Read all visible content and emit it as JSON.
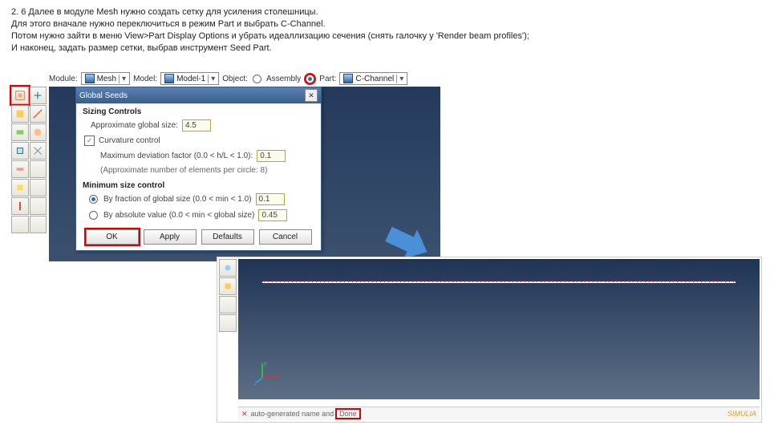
{
  "instructions": {
    "l1": "2. 6 Далее в модуле Mesh нужно создать сетку для усиления столешницы.",
    "l2": "Для этого вначале нужно переключиться в режим Part и выбрать C-Channel.",
    "l3": "Потом нужно зайти в меню View>Part Display Options и убрать идеаллизацию сечения (снять галочку у 'Render beam profiles');",
    "l4": "И наконец, задать размер сетки, выбрав инструмент Seed Part."
  },
  "selectbar": {
    "module_lbl": "Module:",
    "module_val": "Mesh",
    "model_lbl": "Model:",
    "model_val": "Model-1",
    "object_lbl": "Object:",
    "assembly": "Assembly",
    "part_lbl": "Part:",
    "part_val": "C-Channel"
  },
  "dialog": {
    "title": "Global Seeds",
    "section1": "Sizing Controls",
    "approx_lbl": "Approximate global size:",
    "approx_val": "4.5",
    "curv_lbl": "Curvature control",
    "maxdev_lbl": "Maximum deviation factor (0.0 < h/L < 1.0):",
    "maxdev_val": "0.1",
    "approxnum": "(Approximate number of elements per circle: 8)",
    "section2": "Minimum size control",
    "byfrac_lbl": "By fraction of global size (0.0 < min < 1.0)",
    "byfrac_val": "0.1",
    "byabs_lbl": "By absolute value (0.0 < min < global size)",
    "byabs_val": "0.45",
    "ok": "OK",
    "apply": "Apply",
    "defaults": "Defaults",
    "cancel": "Cancel"
  },
  "status": {
    "left": "auto-generated name and",
    "done": "Done",
    "brand": "SIMULIA"
  },
  "axes": {
    "x": "x",
    "y": "y",
    "z": "z"
  }
}
